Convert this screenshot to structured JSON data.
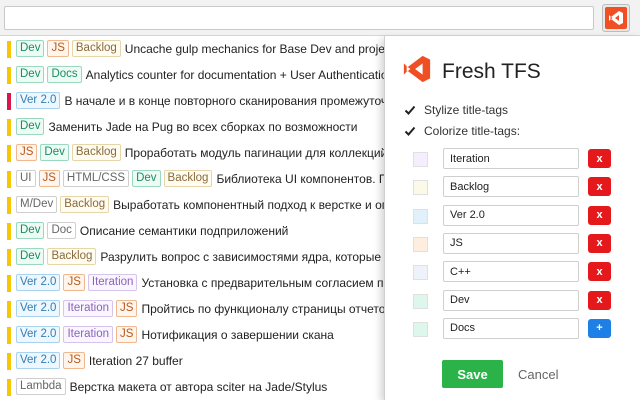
{
  "colors": {
    "accent_orange": "#f04e23",
    "status_yellow": "#f7c600",
    "status_red": "#d6184a",
    "save_green": "#2bb34a",
    "remove_red": "#e5191c",
    "add_blue": "#1e7fe6"
  },
  "toolbar": {
    "extension_icon": "visual-studio-icon"
  },
  "tag_styles": {
    "Dev": {
      "color": "#1a8c68",
      "border": "#9ad8c0",
      "bg": "#eefbf5"
    },
    "JS": {
      "color": "#b35a1f",
      "border": "#f0b88e",
      "bg": "#fff5ec"
    },
    "Backlog": {
      "color": "#8a6a3a",
      "border": "#e6d5a8",
      "bg": "#fffcf1"
    },
    "Docs": {
      "color": "#1a8c68",
      "border": "#9ad8c0",
      "bg": "#eefbf5"
    },
    "Ver 2.0": {
      "color": "#2d7fb8",
      "border": "#a9d2ee",
      "bg": "#eef7fd"
    },
    "UI": {
      "color": "#666666",
      "border": "#cfcfcf",
      "bg": "#ffffff"
    },
    "HTML/CSS": {
      "color": "#666666",
      "border": "#cfcfcf",
      "bg": "#ffffff"
    },
    "M/Dev": {
      "color": "#666666",
      "border": "#cfcfcf",
      "bg": "#ffffff"
    },
    "Doc": {
      "color": "#666666",
      "border": "#cfcfcf",
      "bg": "#ffffff"
    },
    "Iteration": {
      "color": "#8a64b8",
      "border": "#d6c4ec",
      "bg": "#faf6ff"
    },
    "Lambda": {
      "color": "#666666",
      "border": "#cfcfcf",
      "bg": "#ffffff"
    }
  },
  "tasks": [
    {
      "status": "yellow",
      "tags": [
        "Dev",
        "JS",
        "Backlog"
      ],
      "title": "Uncache gulp mechanics for Base Dev and projects"
    },
    {
      "status": "yellow",
      "tags": [
        "Dev",
        "Docs"
      ],
      "title": "Analytics counter for documentation + User Authentication"
    },
    {
      "status": "red",
      "tags": [
        "Ver 2.0"
      ],
      "title": "В начале и в конце повторного сканирования промежуточный"
    },
    {
      "status": "yellow",
      "tags": [
        "Dev"
      ],
      "title": "Заменить Jade на Pug во всех сборках по возможности"
    },
    {
      "status": "yellow",
      "tags": [
        "JS",
        "Dev",
        "Backlog"
      ],
      "title": "Проработать модуль пагинации для коллекций."
    },
    {
      "status": "yellow",
      "tags": [
        "UI",
        "JS",
        "HTML/CSS",
        "Dev",
        "Backlog"
      ],
      "title": "Библиотека UI компонентов. Пор"
    },
    {
      "status": "yellow",
      "tags": [
        "M/Dev",
        "Backlog"
      ],
      "title": "Выработать компонентный подход к верстке и ог"
    },
    {
      "status": "yellow",
      "tags": [
        "Dev",
        "Doc"
      ],
      "title": "Описание семантики подприложений"
    },
    {
      "status": "yellow",
      "tags": [
        "Dev",
        "Backlog"
      ],
      "title": "Разрулить вопрос с зависимостями ядра, которые о"
    },
    {
      "status": "yellow",
      "tags": [
        "Ver 2.0",
        "JS",
        "Iteration"
      ],
      "title": "Установка с предварительным согласием пол"
    },
    {
      "status": "yellow",
      "tags": [
        "Ver 2.0",
        "Iteration",
        "JS"
      ],
      "title": "Пройтись по функционалу страницы отчетов"
    },
    {
      "status": "yellow",
      "tags": [
        "Ver 2.0",
        "Iteration",
        "JS"
      ],
      "title": "Нотификация о завершении скана"
    },
    {
      "status": "yellow",
      "tags": [
        "Ver 2.0",
        "JS"
      ],
      "title": "Iteration 27 buffer"
    },
    {
      "status": "yellow",
      "tags": [
        "Lambda"
      ],
      "title": "Верстка макета от автора sciter на Jade/Stylus"
    }
  ],
  "popup": {
    "logo_icon": "visual-studio-icon",
    "title": "Fresh TFS",
    "stylize_label": "Stylize title-tags",
    "stylize_checked": true,
    "colorize_label": "Colorize title-tags:",
    "colorize_checked": true,
    "tag_rows": [
      {
        "value": "Iteration",
        "swatch": "#f5eefc",
        "action": "x"
      },
      {
        "value": "Backlog",
        "swatch": "#fdf9e8",
        "action": "x"
      },
      {
        "value": "Ver 2.0",
        "swatch": "#e0f1fc",
        "action": "x"
      },
      {
        "value": "JS",
        "swatch": "#fdeee0",
        "action": "x"
      },
      {
        "value": "C++",
        "swatch": "#eef3fb",
        "action": "x"
      },
      {
        "value": "Dev",
        "swatch": "#ddf7ec",
        "action": "x"
      },
      {
        "value": "Docs",
        "swatch": "#ddf7ec",
        "action": "+"
      }
    ],
    "save_label": "Save",
    "cancel_label": "Cancel"
  }
}
